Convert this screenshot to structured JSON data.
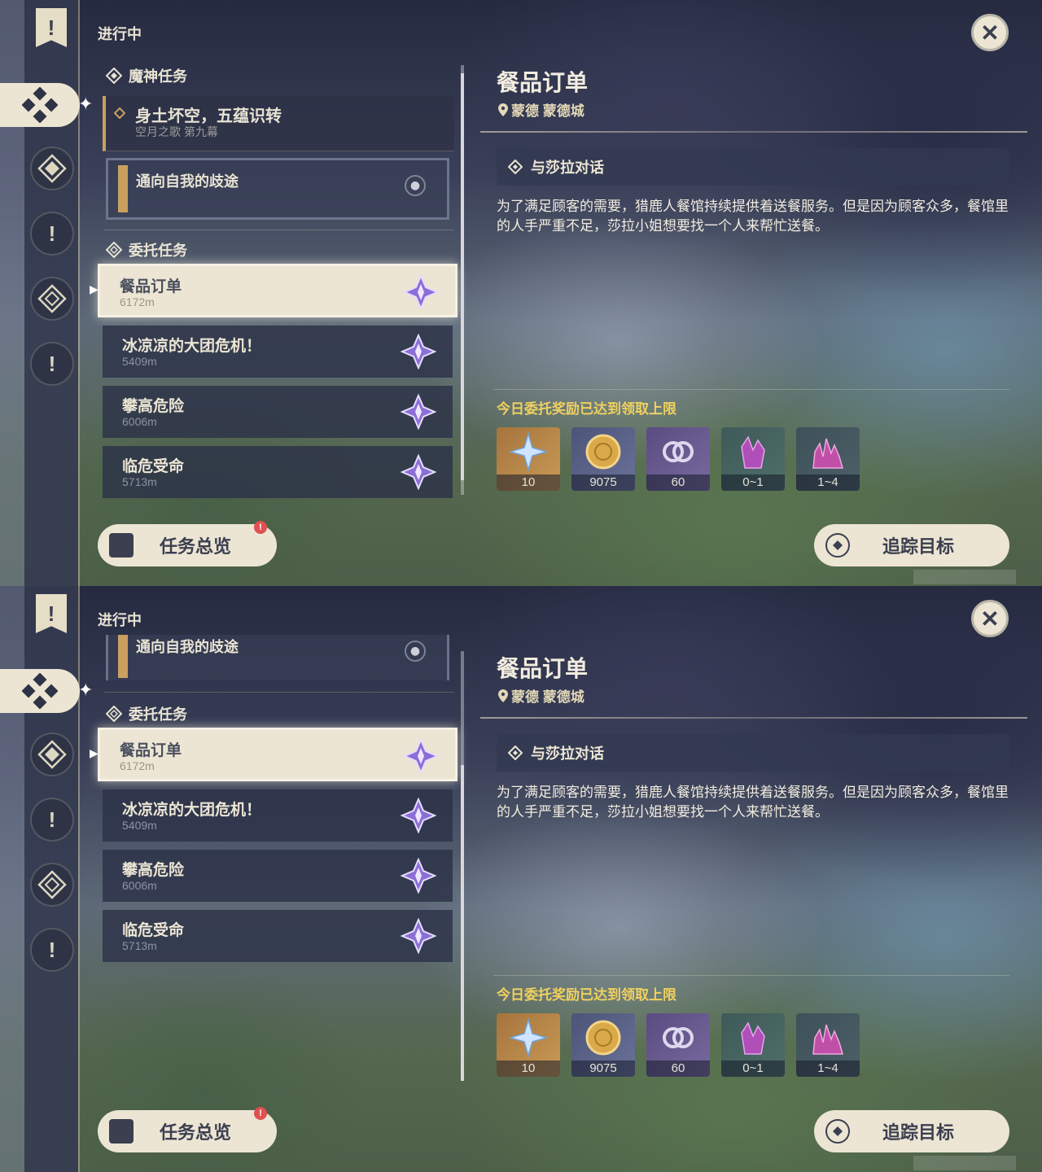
{
  "section_label": "进行中",
  "archon": {
    "category": "魔神任务",
    "main_title": "身土坏空，五蕴识转",
    "main_sub": "空月之歌 第九幕",
    "sub_quest": "通向自我的歧途"
  },
  "commission": {
    "category": "委托任务",
    "quests": [
      {
        "name": "餐品订单",
        "dist": "6172m"
      },
      {
        "name": "冰凉凉的大团危机！",
        "dist": "5409m"
      },
      {
        "name": "攀高危险",
        "dist": "6006m"
      },
      {
        "name": "临危受命",
        "dist": "5713m"
      }
    ]
  },
  "buttons": {
    "overview": "任务总览",
    "overview_badge": "!",
    "track": "追踪目标",
    "close": "✕"
  },
  "detail": {
    "title": "餐品订单",
    "location": "蒙德 蒙德城",
    "objective": "与莎拉对话",
    "description": "为了满足顾客的需要，猎鹿人餐馆持续提供着送餐服务。但是因为顾客众多，餐馆里的人手严重不足，莎拉小姐想要找一个人来帮忙送餐。",
    "limit_text": "今日委托奖励已达到领取上限",
    "rewards": [
      {
        "name": "primogem-icon",
        "count": "10"
      },
      {
        "name": "mora-icon",
        "count": "9075"
      },
      {
        "name": "adventure-exp-icon",
        "count": "60"
      },
      {
        "name": "crystal-chunk-icon",
        "count": "0~1"
      },
      {
        "name": "crystal-cluster-icon",
        "count": "1~4"
      }
    ]
  },
  "colors": {
    "accent_gold": "#c9a060",
    "limit_yellow": "#f0d060",
    "cream": "#ece5d3"
  }
}
